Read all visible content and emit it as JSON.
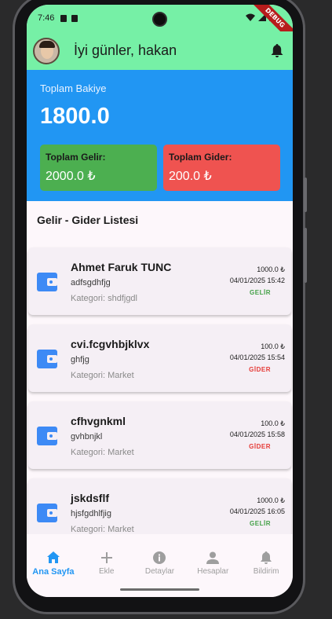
{
  "status_bar": {
    "time": "7:46"
  },
  "debug_banner": "DEBUG",
  "app_bar": {
    "greeting": "İyi günler, hakan"
  },
  "balance": {
    "label": "Toplam Bakiye",
    "value": "1800.0"
  },
  "summary": {
    "income": {
      "title": "Toplam Gelir:",
      "value": "2000.0 ₺"
    },
    "expense": {
      "title": "Toplam Gider:",
      "value": "200.0 ₺"
    }
  },
  "list": {
    "header": "Gelir - Gider Listesi",
    "items": [
      {
        "name": "Ahmet Faruk TUNC",
        "description": "adfsgdhfjg",
        "category": "Kategori: shdfjgdl",
        "amount": "1000.0 ₺",
        "date": "04/01/2025 15:42",
        "type": "GELİR"
      },
      {
        "name": "cvi.fcgvhbjklvx",
        "description": "ghfjg",
        "category": "Kategori: Market",
        "amount": "100.0 ₺",
        "date": "04/01/2025 15:54",
        "type": "GİDER"
      },
      {
        "name": "cfhvgnkml",
        "description": "gvhbnjkl",
        "category": "Kategori: Market",
        "amount": "100.0 ₺",
        "date": "04/01/2025 15:58",
        "type": "GİDER"
      },
      {
        "name": "jskdsflf",
        "description": "hjsfgdhlfjig",
        "category": "Kategori: Market",
        "amount": "1000.0 ₺",
        "date": "04/01/2025 16:05",
        "type": "GELİR"
      }
    ]
  },
  "bottom_nav": [
    {
      "label": "Ana Sayfa",
      "icon": "home-icon",
      "active": true
    },
    {
      "label": "Ekle",
      "icon": "add-icon",
      "active": false
    },
    {
      "label": "Detaylar",
      "icon": "info-icon",
      "active": false
    },
    {
      "label": "Hesaplar",
      "icon": "person-icon",
      "active": false
    },
    {
      "label": "Bildirim",
      "icon": "bell-icon",
      "active": false
    }
  ],
  "colors": {
    "app_bar": "#76f0a6",
    "balance_bg": "#2196f3",
    "income_card": "#4caf50",
    "expense_card": "#ef5350",
    "income_text": "#43a047",
    "expense_text": "#e53935",
    "wallet_icon": "#3d8af5"
  }
}
